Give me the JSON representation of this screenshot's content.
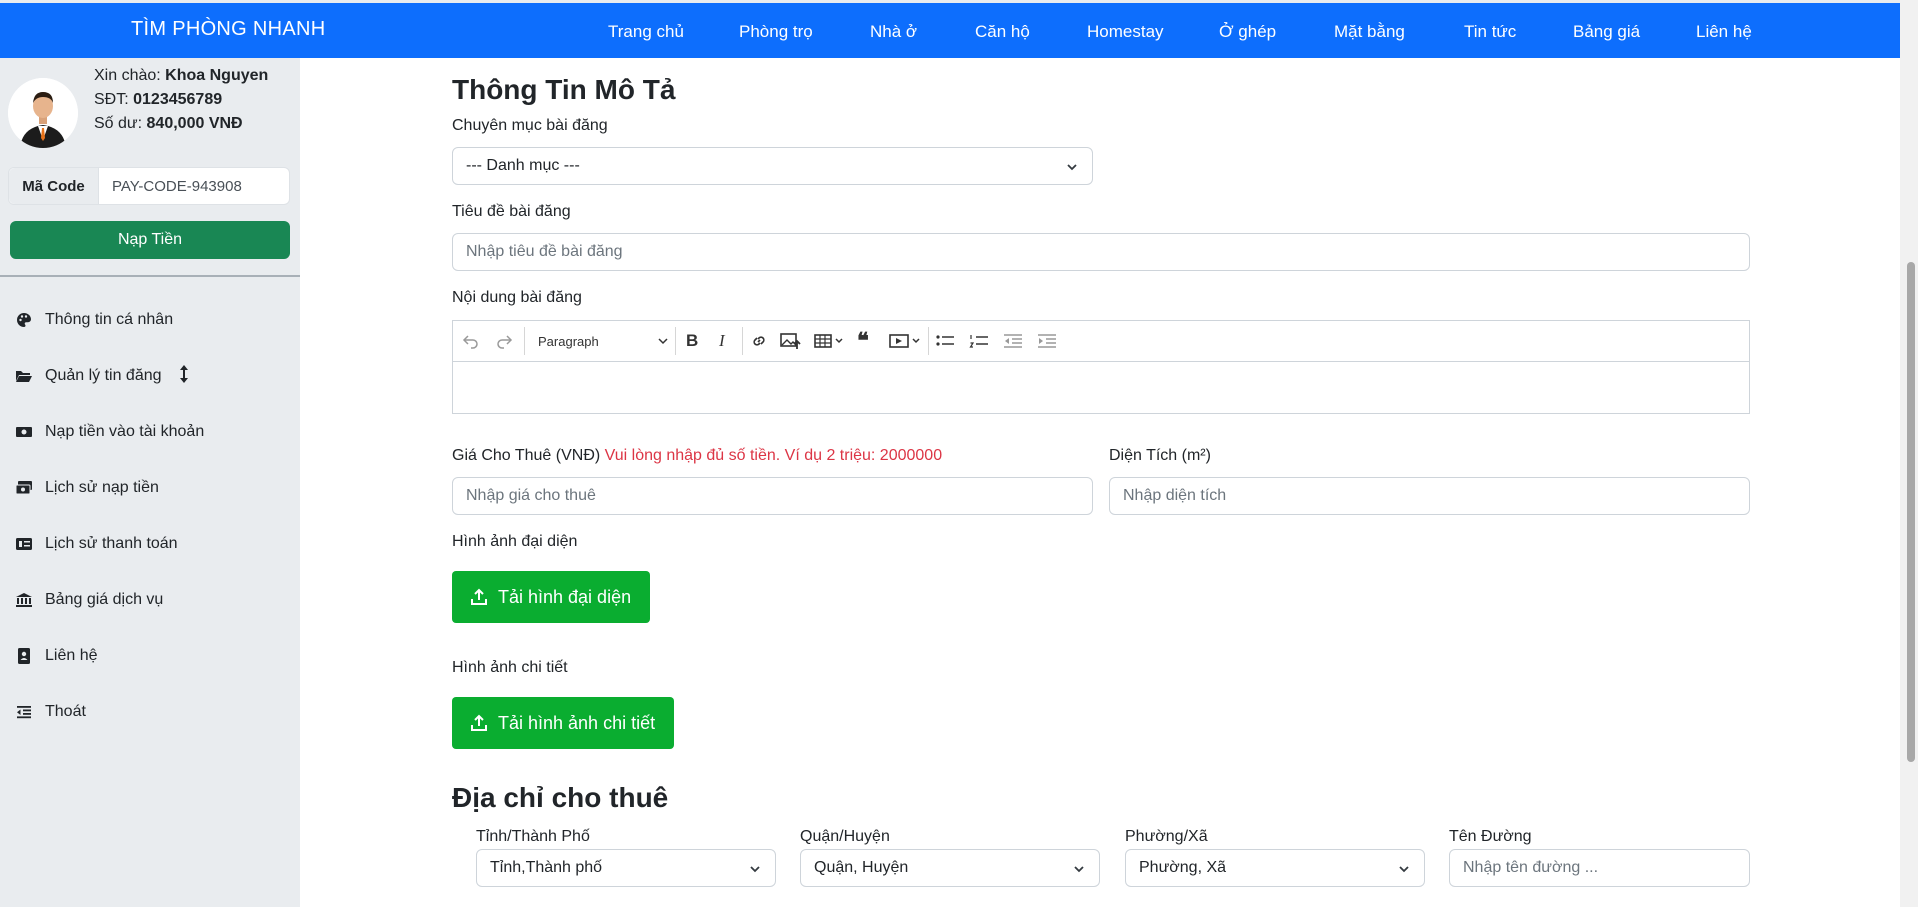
{
  "header": {
    "brand": "TÌM PHÒNG NHANH",
    "nav": [
      "Trang chủ",
      "Phòng trọ",
      "Nhà ở",
      "Căn hộ",
      "Homestay",
      "Ở ghép",
      "Mặt bằng",
      "Tin tức",
      "Bảng giá",
      "Liên hệ"
    ]
  },
  "sidebar": {
    "greeting_label": "Xin chào:",
    "user_name": "Khoa Nguyen",
    "phone_label": "SĐT:",
    "phone": "0123456789",
    "balance_label": "Số dư:",
    "balance": "840,000 VNĐ",
    "code_label": "Mã Code",
    "code_value": "PAY-CODE-943908",
    "topup_button": "Nạp Tiền",
    "menu": [
      {
        "label": "Thông tin cá nhân",
        "icon": "palette-icon"
      },
      {
        "label": "Quản lý tin đăng",
        "icon": "folder-open-icon"
      },
      {
        "label": "Nạp tiền vào tài khoản",
        "icon": "money-bill-icon"
      },
      {
        "label": "Lịch sử nạp tiền",
        "icon": "money-bills-icon"
      },
      {
        "label": "Lịch sử thanh toán",
        "icon": "money-check-icon"
      },
      {
        "label": "Bảng giá dịch vụ",
        "icon": "building-columns-icon"
      },
      {
        "label": "Liên hệ",
        "icon": "address-book-icon"
      },
      {
        "label": "Thoát",
        "icon": "outdent-icon"
      }
    ]
  },
  "form": {
    "section_title": "Thông Tin Mô Tả",
    "category_label": "Chuyên mục bài đăng",
    "category_value": "--- Danh mục ---",
    "title_label": "Tiêu đề bài đăng",
    "title_placeholder": "Nhập tiêu đề bài đăng",
    "content_label": "Nội dung bài đăng",
    "editor_paragraph": "Paragraph",
    "price_label": "Giá Cho Thuê (VNĐ)",
    "price_hint": "Vui lòng nhập đủ số tiền. Ví dụ 2 triệu: 2000000",
    "price_placeholder": "Nhập giá cho thuê",
    "area_label": "Diện Tích (m²)",
    "area_placeholder": "Nhập diện tích",
    "cover_label": "Hình ảnh đại diện",
    "cover_button": "Tải hình đại diện",
    "detail_label": "Hình ảnh chi tiết",
    "detail_button": "Tải hình ảnh chi tiết"
  },
  "address": {
    "section_title": "Địa chỉ cho thuê",
    "province_label": "Tỉnh/Thành Phố",
    "province_value": "Tỉnh,Thành phố",
    "district_label": "Quận/Huyện",
    "district_value": "Quận, Huyện",
    "ward_label": "Phường/Xã",
    "ward_value": "Phường, Xã",
    "street_label": "Tên Đường",
    "street_placeholder": "Nhập tên đường ..."
  },
  "colors": {
    "primary": "#0d6efd",
    "success": "#198754",
    "upload_green": "#0aad30",
    "danger": "#dc3545",
    "sidebar_bg": "#e9ecef"
  }
}
